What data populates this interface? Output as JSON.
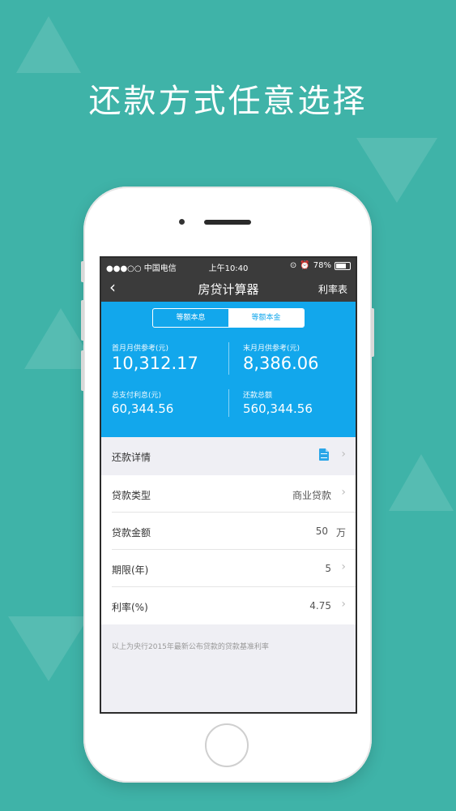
{
  "headline": "还款方式任意选择",
  "colors": {
    "background": "#3fb3a8",
    "accent": "#12a7ec",
    "navbar": "#3b3b3b"
  },
  "statusbar": {
    "carrier": "●●●○○ 中国电信",
    "time": "上午10:40",
    "battery": "78%"
  },
  "navbar": {
    "back_icon": "chevron-left-icon",
    "title": "房贷计算器",
    "right_label": "利率表"
  },
  "segmented": {
    "option_1": "等额本息",
    "option_2": "等额本金",
    "selected": "等额本金"
  },
  "metrics": {
    "first_month_label": "首月月供参考(元)",
    "first_month_value": "10,312.17",
    "last_month_label": "末月月供参考(元)",
    "last_month_value": "8,386.06",
    "total_interest_label": "总支付利息(元)",
    "total_interest_value": "60,344.56",
    "total_repay_label": "还款总额",
    "total_repay_value": "560,344.56"
  },
  "rows": {
    "details_label": "还款详情",
    "loan_type_label": "贷款类型",
    "loan_type_value": "商业贷款",
    "loan_amount_label": "贷款金额",
    "loan_amount_value": "50",
    "loan_amount_unit": "万",
    "term_label": "期限(年)",
    "term_value": "5",
    "rate_label": "利率(%)",
    "rate_value": "4.75"
  },
  "note": "以上为央行2015年最新公布贷款的贷款基准利率"
}
